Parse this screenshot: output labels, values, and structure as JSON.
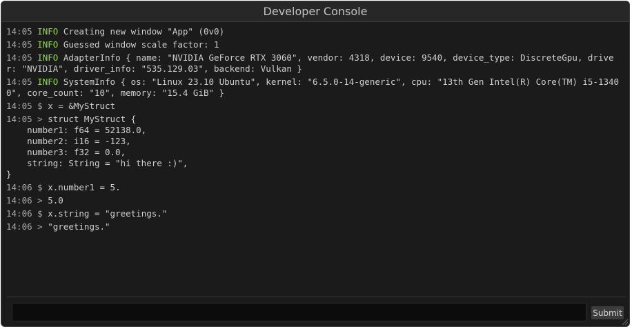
{
  "window": {
    "title": "Developer Console"
  },
  "log": [
    {
      "kind": "info",
      "time": "14:05",
      "level": "INFO",
      "text": "Creating new window \"App\" (0v0)"
    },
    {
      "kind": "info",
      "time": "14:05",
      "level": "INFO",
      "text": "Guessed window scale factor: 1"
    },
    {
      "kind": "info",
      "time": "14:05",
      "level": "INFO",
      "text": "AdapterInfo { name: \"NVIDIA GeForce RTX 3060\", vendor: 4318, device: 9540, device_type: DiscreteGpu, driver: \"NVIDIA\", driver_info: \"535.129.03\", backend: Vulkan }"
    },
    {
      "kind": "info",
      "time": "14:05",
      "level": "INFO",
      "text": "SystemInfo { os: \"Linux 23.10 Ubuntu\", kernel: \"6.5.0-14-generic\", cpu: \"13th Gen Intel(R) Core(TM) i5-13400\", core_count: \"10\", memory: \"15.4 GiB\" }"
    },
    {
      "kind": "cmd",
      "time": "14:05",
      "prompt": "$",
      "text": "x = &MyStruct"
    },
    {
      "kind": "cmd",
      "time": "14:05",
      "prompt": ">",
      "text": "struct MyStruct {\n    number1: f64 = 52138.0,\n    number2: i16 = -123,\n    number3: f32 = 0.0,\n    string: String = \"hi there :)\",\n}"
    },
    {
      "kind": "cmd",
      "time": "14:06",
      "prompt": "$",
      "text": "x.number1 = 5."
    },
    {
      "kind": "cmd",
      "time": "14:06",
      "prompt": ">",
      "text": "5.0"
    },
    {
      "kind": "cmd",
      "time": "14:06",
      "prompt": "$",
      "text": "x.string = \"greetings.\""
    },
    {
      "kind": "cmd",
      "time": "14:06",
      "prompt": ">",
      "text": "\"greetings.\""
    }
  ],
  "input": {
    "value": "",
    "placeholder": ""
  },
  "submit": {
    "label": "Submit"
  },
  "colors": {
    "background": "#1b1b1b",
    "titlebar": "#272727",
    "info_level": "#8fd94f",
    "timestamp": "#a9a9a9",
    "text": "#cfcfcf"
  },
  "icons": {
    "resize": "resize-grip-icon"
  }
}
